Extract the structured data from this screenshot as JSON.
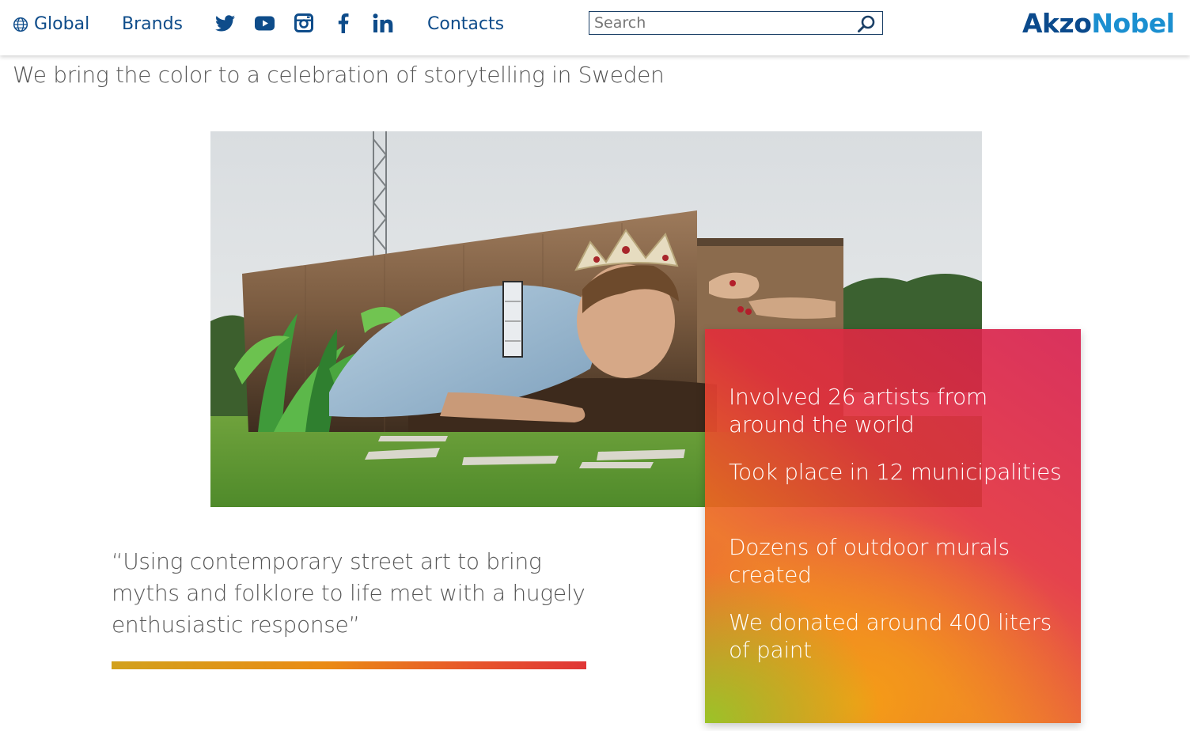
{
  "header": {
    "nav": {
      "global": "Global",
      "brands": "Brands",
      "contacts": "Contacts"
    },
    "social": [
      "twitter-icon",
      "youtube-icon",
      "instagram-icon",
      "facebook-icon",
      "linkedin-icon"
    ],
    "search": {
      "placeholder": "Search",
      "value": ""
    },
    "logo": {
      "part1": "Akzo",
      "part2": "Nobel"
    }
  },
  "main": {
    "title": "We bring the color to a celebration of storytelling in Sweden",
    "quote": "“Using contemporary street art to bring myths and folklore to life met with a hugely enthusiastic response”",
    "facts": [
      "Involved 26 artists from around the world",
      "Took place in 12 municipalities",
      "Dozens of outdoor murals created",
      "We donated around 400 liters of paint"
    ]
  },
  "colors": {
    "nav": "#0e4c8a",
    "logo_dark": "#0b4a8c",
    "logo_light": "#1b8fd0",
    "text": "#555555"
  }
}
